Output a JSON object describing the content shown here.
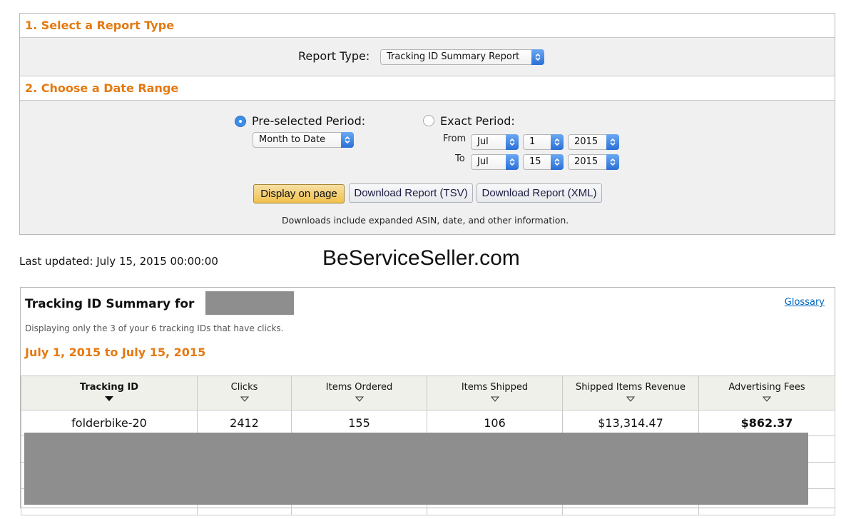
{
  "section1": {
    "title": "1. Select a Report Type",
    "report_type_label": "Report Type:",
    "report_type_value": "Tracking ID Summary Report"
  },
  "section2": {
    "title": "2. Choose a Date Range",
    "preselected_label": "Pre-selected Period:",
    "preselected_selected": true,
    "preselected_value": "Month to Date",
    "exact_label": "Exact Period:",
    "from_label": "From",
    "to_label": "To",
    "from": {
      "month": "Jul",
      "day": "1",
      "year": "2015"
    },
    "to": {
      "month": "Jul",
      "day": "15",
      "year": "2015"
    },
    "buttons": {
      "display": "Display on page",
      "tsv": "Download Report (TSV)",
      "xml": "Download Report (XML)"
    },
    "downloads_note": "Downloads include expanded ASIN, date, and other information."
  },
  "last_updated": "Last updated: July 15, 2015 00:00:00",
  "watermark": "BeServiceSeller.com",
  "summary": {
    "title": "Tracking ID Summary for",
    "glossary": "Glossary",
    "note": "Displaying only the 3 of your 6 tracking IDs that have clicks.",
    "date_range": "July 1, 2015 to July 15, 2015",
    "columns": [
      "Tracking ID",
      "Clicks",
      "Items Ordered",
      "Items Shipped",
      "Shipped Items Revenue",
      "Advertising Fees"
    ],
    "rows": [
      [
        "folderbike-20",
        "2412",
        "155",
        "106",
        "$13,314.47",
        "$862.37"
      ]
    ]
  },
  "colors": {
    "accent": "#e47911",
    "link": "#0066c0",
    "button_primary": "#f0c14b",
    "select_arrow": "#2b6fd7",
    "redaction": "#8e8e8e"
  },
  "icons": {
    "select": "chevron-up-down-icon",
    "sort_active": "triangle-down-filled-icon",
    "sort_inactive": "triangle-down-outline-icon"
  }
}
